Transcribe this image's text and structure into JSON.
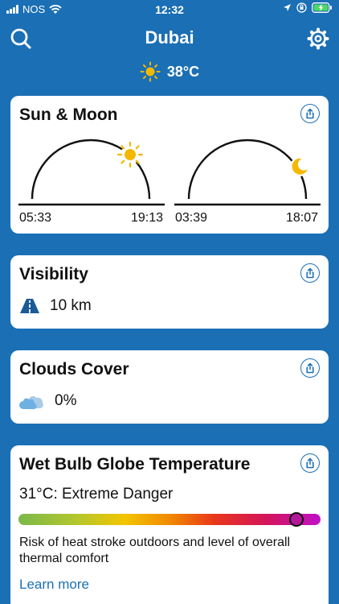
{
  "status_bar": {
    "carrier": "NOS",
    "time": "12:32"
  },
  "header": {
    "title": "Dubai"
  },
  "current": {
    "temperature": "38°C",
    "icon": "sun-icon"
  },
  "sun_moon": {
    "title": "Sun & Moon",
    "sunrise": "05:33",
    "sunset": "19:13",
    "moonrise": "03:39",
    "moonset": "18:07"
  },
  "visibility": {
    "title": "Visibility",
    "value": "10 km"
  },
  "clouds": {
    "title": "Clouds Cover",
    "value": "0%"
  },
  "wbgt": {
    "title": "Wet Bulb Globe Temperature",
    "level": "31°C: Extreme Danger",
    "description": "Risk of heat stroke outdoors and level of overall thermal comfort",
    "link": "Learn more"
  },
  "colors": {
    "background": "#1a6fb5",
    "sun": "#f5b800",
    "moon": "#f5b800",
    "accent": "#1a6fb5"
  }
}
